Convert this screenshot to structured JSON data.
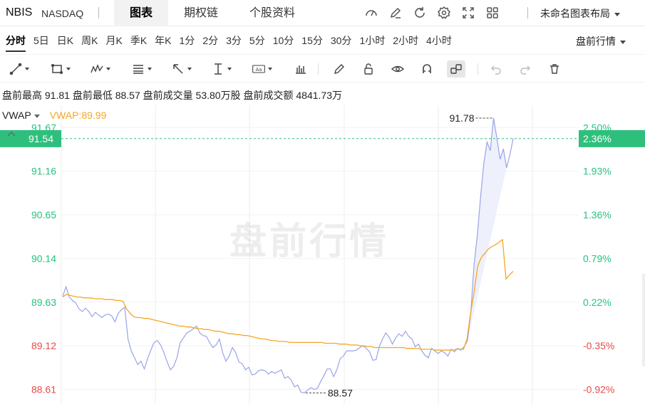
{
  "header": {
    "symbol": "NBIS",
    "exchange": "NASDAQ",
    "tabs": [
      {
        "label": "图表",
        "active": true
      },
      {
        "label": "期权链",
        "active": false
      },
      {
        "label": "个股资料",
        "active": false
      }
    ],
    "icons": [
      "gauge-icon",
      "pencil-icon",
      "refresh-icon",
      "gear-icon",
      "fullscreen-icon",
      "grid-icon"
    ],
    "layout_name": "未命名图表布局"
  },
  "periods": {
    "items": [
      "分时",
      "5日",
      "日K",
      "周K",
      "月K",
      "季K",
      "年K",
      "1分",
      "2分",
      "3分",
      "5分",
      "10分",
      "15分",
      "30分",
      "1小时",
      "2小时",
      "4小时"
    ],
    "active": "分时",
    "session_label": "盘前行情"
  },
  "toolbar": {
    "tools": [
      "line-tool-icon",
      "rectangle-tool-icon",
      "pattern-tool-icon",
      "fib-tool-icon",
      "arrow-tool-icon",
      "measure-tool-icon",
      "text-tool-icon",
      "bar-type-icon",
      "pen-icon",
      "lock-icon",
      "eye-icon",
      "magnet-icon",
      "link-icon",
      "undo-icon",
      "redo-icon",
      "trash-icon"
    ]
  },
  "stats": {
    "high_label": "盘前最高",
    "high": "91.81",
    "low_label": "盘前最低",
    "low": "88.57",
    "volume_label": "盘前成交量",
    "volume": "53.80万股",
    "turnover_label": "盘前成交额",
    "turnover": "4841.73万"
  },
  "indicator": {
    "name": "VWAP",
    "value_text": "VWAP:89.99"
  },
  "watermark": "盘前行情",
  "colors": {
    "price_line": "#9aa3e8",
    "price_fill": "#eef0fb",
    "vwap_line": "#f5a623",
    "up": "#26c281",
    "down": "#e84a4a",
    "current_tag": "#2fbf7d"
  },
  "chart_data": {
    "type": "line",
    "reference_price": 89.43,
    "ylim": [
      88.44,
      91.93
    ],
    "price_ticks": [
      "91.67",
      "91.16",
      "90.65",
      "90.14",
      "89.63",
      "89.12",
      "88.61"
    ],
    "pct_ticks": [
      "2.50%",
      "1.93%",
      "1.36%",
      "0.79%",
      "0.22%",
      "-0.35%",
      "-0.92%"
    ],
    "current_price": "91.54",
    "current_pct": "2.36%",
    "high_annotation": "91.78",
    "low_annotation": "88.57",
    "series": [
      {
        "name": "Price",
        "values": [
          89.7,
          89.81,
          89.69,
          89.65,
          89.62,
          89.55,
          89.52,
          89.56,
          89.52,
          89.46,
          89.51,
          89.48,
          89.45,
          89.48,
          89.49,
          89.47,
          89.4,
          89.5,
          89.54,
          89.57,
          89.2,
          89.06,
          88.98,
          88.9,
          88.94,
          88.85,
          88.97,
          89.07,
          89.16,
          89.18,
          89.13,
          89.04,
          88.93,
          88.84,
          88.88,
          88.98,
          89.16,
          89.21,
          89.27,
          89.29,
          89.32,
          89.35,
          89.27,
          89.24,
          89.23,
          89.16,
          89.1,
          89.13,
          89.2,
          89.04,
          88.94,
          89.0,
          89.1,
          89.04,
          88.93,
          88.91,
          88.84,
          88.87,
          88.78,
          88.79,
          88.83,
          88.84,
          88.83,
          88.79,
          88.82,
          88.8,
          88.82,
          88.84,
          88.74,
          88.76,
          88.72,
          88.64,
          88.66,
          88.58,
          88.57,
          88.6,
          88.63,
          88.61,
          88.62,
          88.7,
          88.77,
          88.85,
          88.85,
          88.76,
          88.84,
          88.97,
          89.0,
          89.06,
          89.06,
          89.06,
          89.07,
          89.1,
          89.12,
          89.09,
          89.05,
          88.95,
          88.96,
          89.11,
          89.2,
          89.27,
          89.22,
          89.14,
          89.21,
          89.26,
          89.23,
          89.29,
          89.23,
          89.2,
          89.11,
          89.14,
          89.06,
          89.01,
          88.98,
          89.09,
          89.06,
          89.03,
          89.06,
          89.04,
          89.0,
          89.08,
          89.05,
          89.09,
          89.07,
          89.11,
          89.18,
          89.5,
          90.05,
          90.4,
          90.85,
          91.25,
          91.5,
          91.4,
          91.78,
          91.55,
          91.3,
          91.42,
          91.2,
          91.35,
          91.54
        ],
        "color": "price_line"
      },
      {
        "name": "VWAP",
        "values": [
          89.69,
          89.72,
          89.71,
          89.7,
          89.69,
          89.69,
          89.68,
          89.68,
          89.68,
          89.67,
          89.67,
          89.67,
          89.66,
          89.66,
          89.66,
          89.65,
          89.65,
          89.64,
          89.55,
          89.5,
          89.46,
          89.45,
          89.45,
          89.44,
          89.44,
          89.43,
          89.42,
          89.41,
          89.4,
          89.39,
          89.38,
          89.37,
          89.36,
          89.35,
          89.35,
          89.34,
          89.34,
          89.33,
          89.32,
          89.32,
          89.31,
          89.31,
          89.3,
          89.29,
          89.29,
          89.28,
          89.27,
          89.26,
          89.26,
          89.25,
          89.25,
          89.24,
          89.24,
          89.23,
          89.22,
          89.21,
          89.2,
          89.2,
          89.19,
          89.18,
          89.18,
          89.17,
          89.17,
          89.17,
          89.16,
          89.16,
          89.16,
          89.16,
          89.16,
          89.16,
          89.16,
          89.16,
          89.16,
          89.16,
          89.15,
          89.15,
          89.15,
          89.15,
          89.14,
          89.14,
          89.14,
          89.13,
          89.13,
          89.13,
          89.12,
          89.12,
          89.11,
          89.11,
          89.1,
          89.1,
          89.1,
          89.1,
          89.1,
          89.1,
          89.1,
          89.1,
          89.1,
          89.09,
          89.09,
          89.09,
          89.09,
          89.08,
          89.08,
          89.08,
          89.08,
          89.07,
          89.07,
          89.07,
          89.07,
          89.07,
          89.07,
          89.08,
          89.08,
          89.08,
          89.2,
          89.5,
          89.75,
          90.05,
          90.15,
          90.2,
          90.25,
          90.28,
          90.3,
          90.33,
          90.36,
          89.9,
          89.95,
          89.99
        ],
        "color": "vwap_line"
      }
    ]
  }
}
